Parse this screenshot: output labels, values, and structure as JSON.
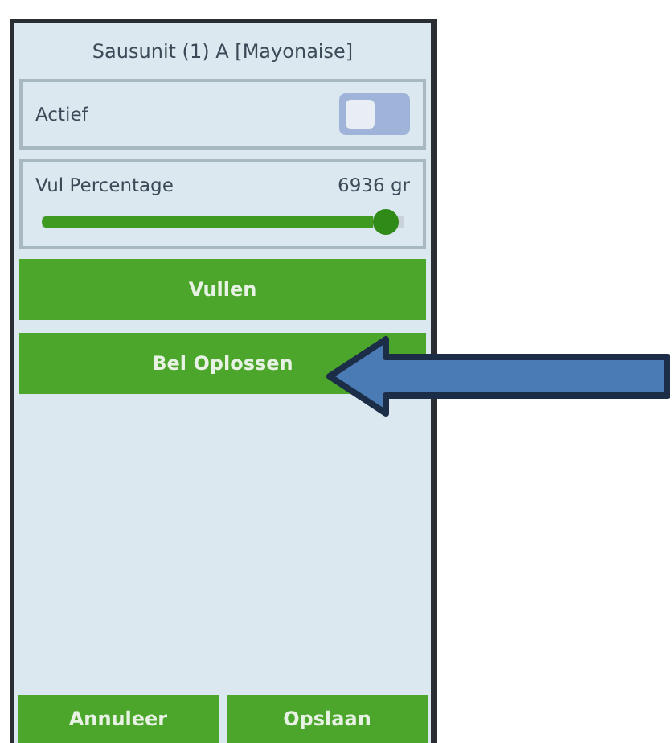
{
  "title": "Sausunit (1) A [Mayonaise]",
  "toggle": {
    "label": "Actief",
    "on": false
  },
  "slider": {
    "label": "Vul Percentage",
    "reading": "6936 gr",
    "level": 0.95
  },
  "actions": [
    {
      "label": "Vullen"
    },
    {
      "label": "Bel Oplossen"
    }
  ],
  "footer_buttons": [
    {
      "label": "Annuleer"
    },
    {
      "label": "Opslaan"
    }
  ]
}
